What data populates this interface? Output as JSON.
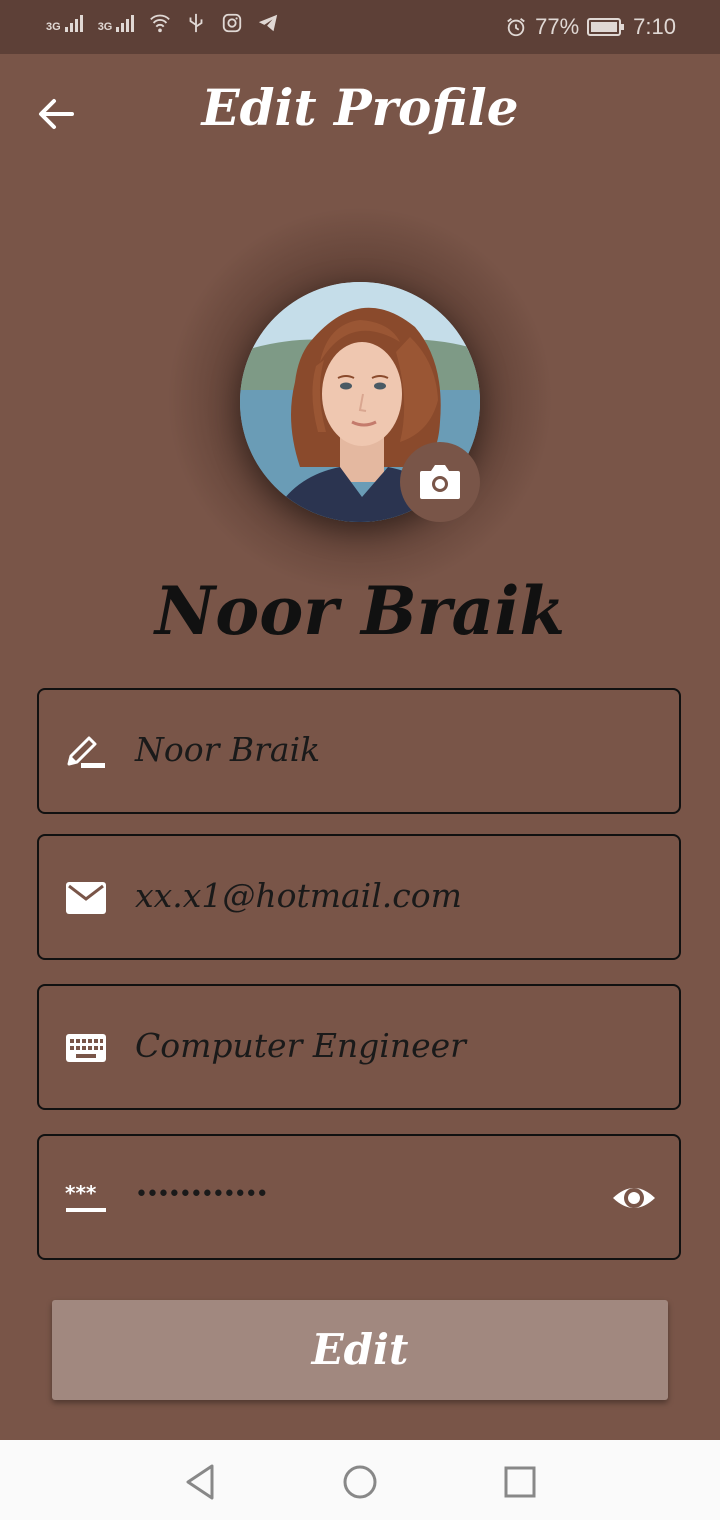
{
  "status": {
    "signal1": "3G",
    "signal2": "3G",
    "battery": "77%",
    "time": "7:10"
  },
  "appbar": {
    "title": "Edit Profile"
  },
  "profile": {
    "name": "Noor Braik"
  },
  "fields": {
    "name": "Noor Braik",
    "email": "xx.x1@hotmail.com",
    "job": "Computer Engineer",
    "password": "••••••••••••"
  },
  "button": {
    "label": "Edit"
  },
  "colors": {
    "background": "#795548",
    "statusbar": "#5d4037",
    "button": "#a1887f"
  }
}
